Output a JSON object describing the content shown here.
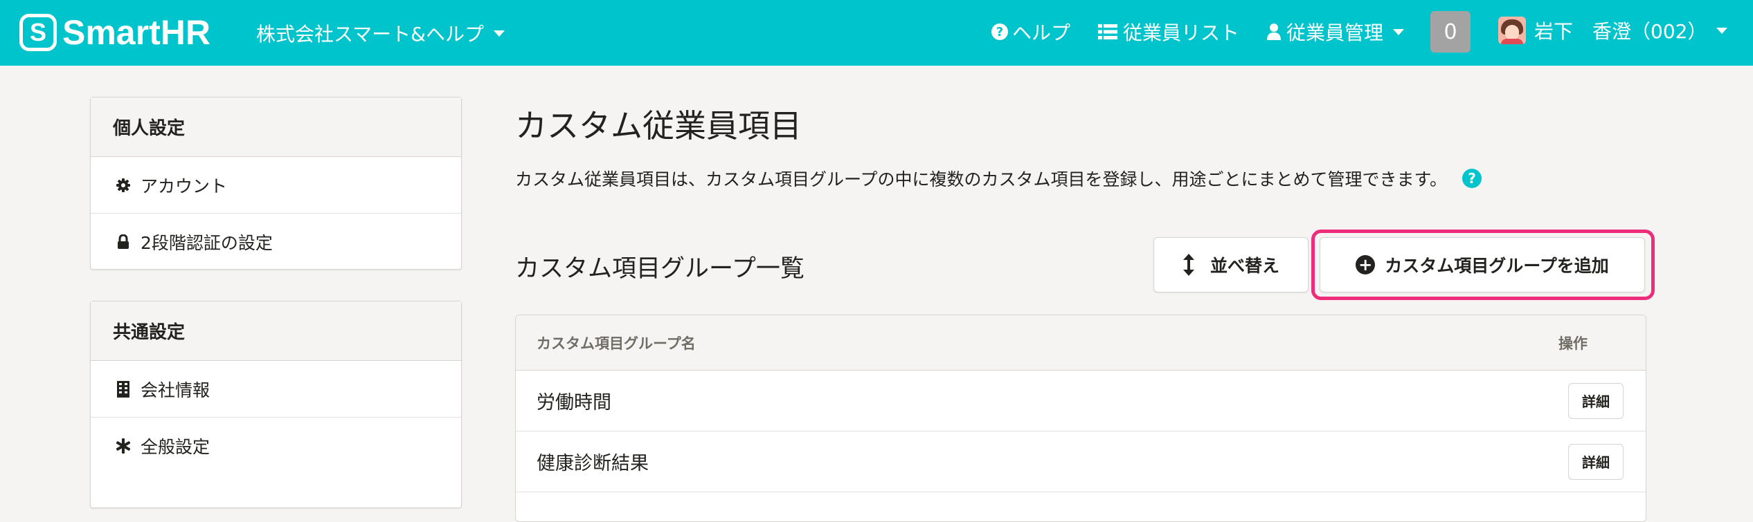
{
  "header": {
    "logo_mark": "S",
    "logo_text": "SmartHR",
    "company": "株式会社スマート&ヘルプ",
    "nav": {
      "help": "ヘルプ",
      "employee_list": "従業員リスト",
      "employee_manage": "従業員管理"
    },
    "notification_count": "0",
    "user_name": "岩下　香澄（002）"
  },
  "sidebar": {
    "personal": {
      "title": "個人設定",
      "items": [
        {
          "label": "アカウント",
          "icon": "gear-icon"
        },
        {
          "label": "2段階認証の設定",
          "icon": "lock-icon"
        }
      ]
    },
    "common": {
      "title": "共通設定",
      "items": [
        {
          "label": "会社情報",
          "icon": "building-icon"
        },
        {
          "label": "全般設定",
          "icon": "asterisk-icon"
        }
      ]
    }
  },
  "main": {
    "title": "カスタム従業員項目",
    "description": "カスタム従業員項目は、カスタム項目グループの中に複数のカスタム項目を登録し、用途ごとにまとめて管理できます。",
    "section_title": "カスタム項目グループ一覧",
    "sort_button": "並べ替え",
    "add_button": "カスタム項目グループを追加",
    "table": {
      "columns": [
        "カスタム項目グループ名",
        "操作"
      ],
      "rows": [
        {
          "name": "労働時間",
          "action": "詳細"
        },
        {
          "name": "健康診断結果",
          "action": "詳細"
        }
      ]
    }
  },
  "colors": {
    "brand": "#00c4cc",
    "highlight": "#ee2d7a"
  }
}
